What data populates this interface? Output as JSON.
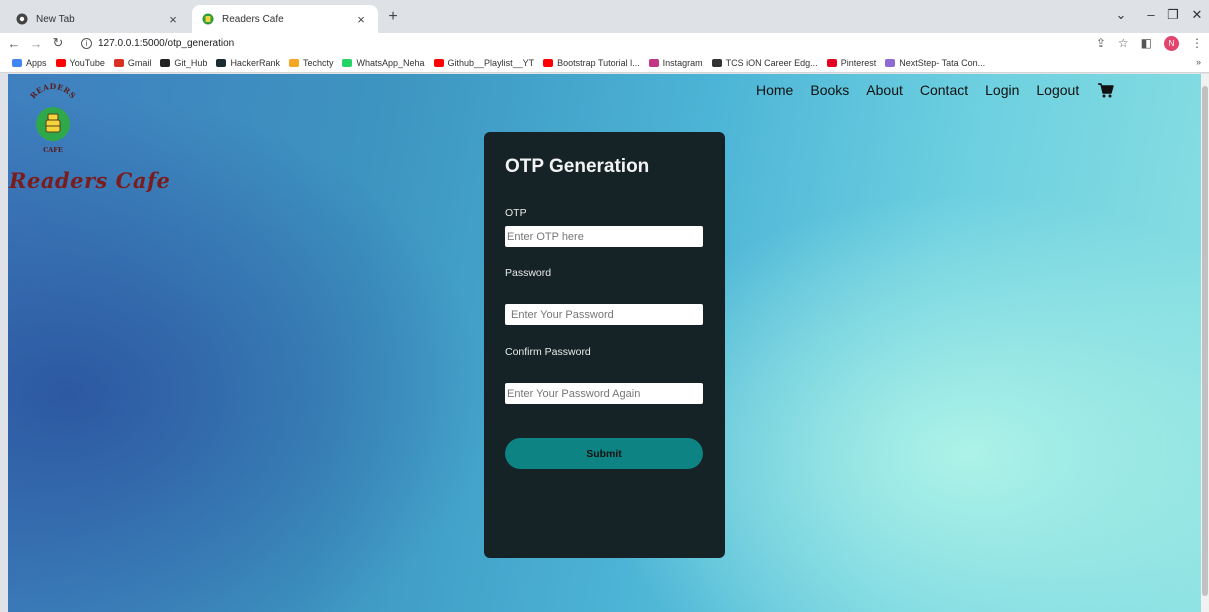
{
  "browser": {
    "tabs": [
      {
        "title": "New Tab",
        "active": false
      },
      {
        "title": "Readers Cafe",
        "active": true
      }
    ],
    "url": "127.0.0.1:5000/otp_generation",
    "bookmarks": [
      {
        "label": "Apps",
        "color": "#4285f4"
      },
      {
        "label": "YouTube",
        "color": "#ff0000"
      },
      {
        "label": "Gmail",
        "color": "#d93025"
      },
      {
        "label": "Git_Hub",
        "color": "#222222"
      },
      {
        "label": "HackerRank",
        "color": "#1b2b34"
      },
      {
        "label": "Techcty",
        "color": "#f5a623"
      },
      {
        "label": "WhatsApp_Neha",
        "color": "#25d366"
      },
      {
        "label": "Github__Playlist__YT",
        "color": "#ff0000"
      },
      {
        "label": "Bootstrap Tutorial l...",
        "color": "#ff0000"
      },
      {
        "label": "Instagram",
        "color": "#c13584"
      },
      {
        "label": "TCS iON Career Edg...",
        "color": "#333333"
      },
      {
        "label": "Pinterest",
        "color": "#e60023"
      },
      {
        "label": "NextStep- Tata Con...",
        "color": "#8e6bd4"
      }
    ],
    "profile_initial": "N"
  },
  "site": {
    "logo_top_text": "READERS",
    "logo_bottom_text": "CAFE",
    "brand": "Readers Cafe",
    "nav": [
      "Home",
      "Books",
      "About",
      "Contact",
      "Login",
      "Logout"
    ]
  },
  "form": {
    "title": "OTP Generation",
    "otp_label": "OTP",
    "otp_placeholder": "Enter OTP here",
    "password_label": "Password",
    "password_placeholder": "Enter Your Password",
    "confirm_label": "Confirm Password",
    "confirm_placeholder": "Enter Your Password Again",
    "submit_label": "Submit"
  },
  "colors": {
    "card_bg": "#162326",
    "submit_bg": "#0e8383",
    "brand_text": "#7a1c1c"
  }
}
